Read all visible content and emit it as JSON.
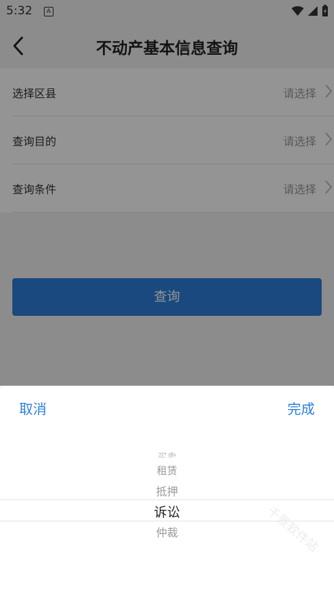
{
  "status_bar": {
    "time": "5:32",
    "app_icon_letter": "A"
  },
  "nav": {
    "title": "不动产基本信息查询"
  },
  "form": {
    "rows": [
      {
        "label": "选择区县",
        "value": "请选择"
      },
      {
        "label": "查询目的",
        "value": "请选择"
      },
      {
        "label": "查询条件",
        "value": "请选择"
      }
    ]
  },
  "query_button": {
    "label": "查询"
  },
  "picker": {
    "cancel_label": "取消",
    "done_label": "完成",
    "items": [
      "买卖",
      "租赁",
      "抵押",
      "诉讼",
      "仲裁"
    ],
    "selected": "诉讼"
  },
  "watermark": {
    "text": "千景软件站"
  },
  "colors": {
    "accent": "#2b7fd9",
    "placeholder": "#999999",
    "title": "#222222"
  },
  "icons": {
    "back": "chevron-left-icon",
    "row_arrow": "chevron-right-icon"
  }
}
